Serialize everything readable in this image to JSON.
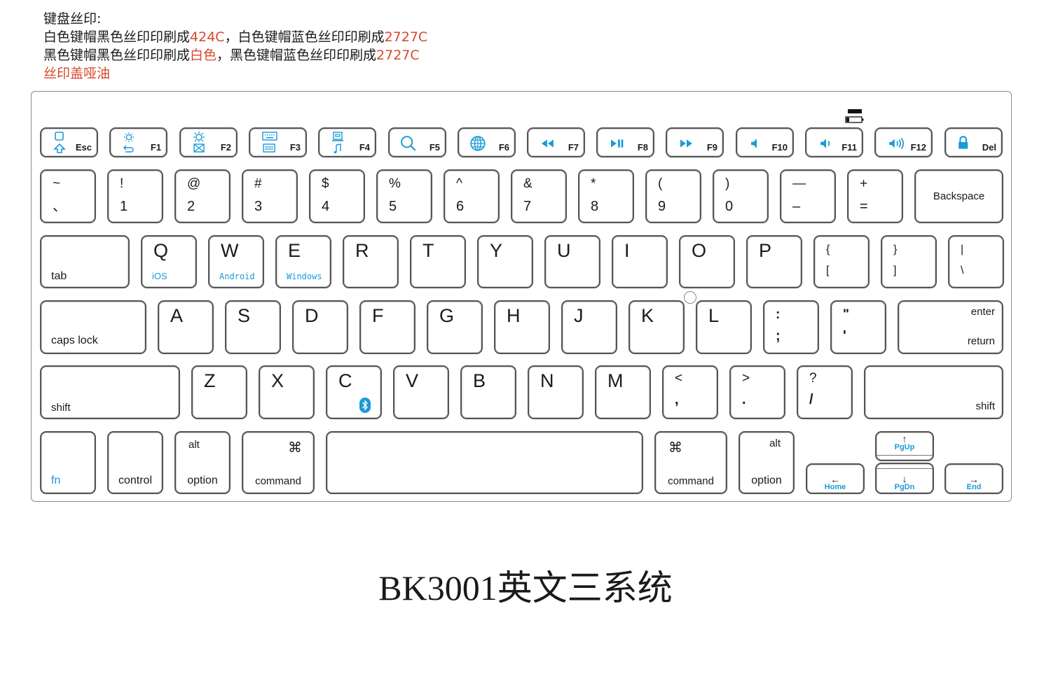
{
  "notes": {
    "line1": "键盘丝印:",
    "line2_a": "白色键帽黑色丝印印刷成",
    "line2_b": "424C",
    "line2_c": "，白色键帽蓝色丝印印刷成",
    "line2_d": "2727C",
    "line3_a": "黑色键帽黑色丝印印刷成",
    "line3_b": "白色",
    "line3_c": "，黑色键帽蓝色丝印印刷成",
    "line3_d": "2727C",
    "line4": "丝印盖哑油",
    "accent_color": "#d9472b"
  },
  "colors": {
    "blue_print": "#1a9ad6",
    "key_border": "#555555"
  },
  "fn_row": [
    {
      "label": "Esc",
      "icon": "home-icon",
      "icon2": "shift-arrow-icon"
    },
    {
      "label": "F1",
      "icon": "brightness-low-icon",
      "icon2": "back-icon"
    },
    {
      "label": "F2",
      "icon": "brightness-high-icon",
      "icon2": "mail-icon"
    },
    {
      "label": "F3",
      "icon": "keyboard-icon",
      "icon2": "menu-icon"
    },
    {
      "label": "F4",
      "icon": "screen-icon",
      "icon2": "music-icon"
    },
    {
      "label": "F5",
      "icon": "search-icon"
    },
    {
      "label": "F6",
      "icon": "globe-icon"
    },
    {
      "label": "F7",
      "icon": "rewind-icon"
    },
    {
      "label": "F8",
      "icon": "play-pause-icon"
    },
    {
      "label": "F9",
      "icon": "fast-forward-icon"
    },
    {
      "label": "F10",
      "icon": "volume-mute-icon"
    },
    {
      "label": "F11",
      "icon": "volume-down-icon"
    },
    {
      "label": "F12",
      "icon": "volume-up-icon"
    },
    {
      "label": "Del",
      "icon": "lock-icon"
    }
  ],
  "num_row": [
    {
      "top": "~",
      "bottom": "、"
    },
    {
      "top": "!",
      "bottom": "1"
    },
    {
      "top": "@",
      "bottom": "2"
    },
    {
      "top": "#",
      "bottom": "3"
    },
    {
      "top": "$",
      "bottom": "4"
    },
    {
      "top": "%",
      "bottom": "5"
    },
    {
      "top": "^",
      "bottom": "6"
    },
    {
      "top": "&",
      "bottom": "7"
    },
    {
      "top": "*",
      "bottom": "8"
    },
    {
      "top": "(",
      "bottom": "9"
    },
    {
      "top": ")",
      "bottom": "0"
    },
    {
      "top": "—",
      "bottom": "–"
    },
    {
      "top": "+",
      "bottom": "="
    }
  ],
  "backspace": "Backspace",
  "tab": "tab",
  "qwerty": [
    {
      "top": "Q",
      "sub": "iOS"
    },
    {
      "top": "W",
      "sub": "Android"
    },
    {
      "top": "E",
      "sub": "Windows"
    },
    {
      "top": "R"
    },
    {
      "top": "T"
    },
    {
      "top": "Y"
    },
    {
      "top": "U"
    },
    {
      "top": "I"
    },
    {
      "top": "O"
    },
    {
      "top": "P"
    }
  ],
  "brackets": [
    {
      "top": "{",
      "bottom": "["
    },
    {
      "top": "}",
      "bottom": "]"
    },
    {
      "top": "|",
      "bottom": "\\"
    }
  ],
  "caps": "caps lock",
  "home_row": [
    "A",
    "S",
    "D",
    "F",
    "G",
    "H",
    "J",
    "K",
    "L"
  ],
  "home_punct": [
    {
      "top": ":",
      "bottom": ";"
    },
    {
      "top": "\"",
      "bottom": "'"
    }
  ],
  "enter": {
    "top": "enter",
    "bottom": "return"
  },
  "shift": "shift",
  "bottom_letters": [
    "Z",
    "X",
    "C",
    "V",
    "B",
    "N",
    "M"
  ],
  "bottom_punct": [
    {
      "top": "<",
      "bottom": ","
    },
    {
      "top": ">",
      "bottom": "."
    },
    {
      "top": "?",
      "bottom": "/"
    }
  ],
  "mods": {
    "fn": "fn",
    "control": "control",
    "alt": "alt",
    "option": "option",
    "cmd_symbol": "⌘",
    "command": "command"
  },
  "nav": {
    "pgup": "PgUp",
    "pgdn": "PgDn",
    "home": "Home",
    "end": "End",
    "up": "↑",
    "down": "↓",
    "left": "←",
    "right": "→"
  },
  "title": "BK3001英文三系统"
}
